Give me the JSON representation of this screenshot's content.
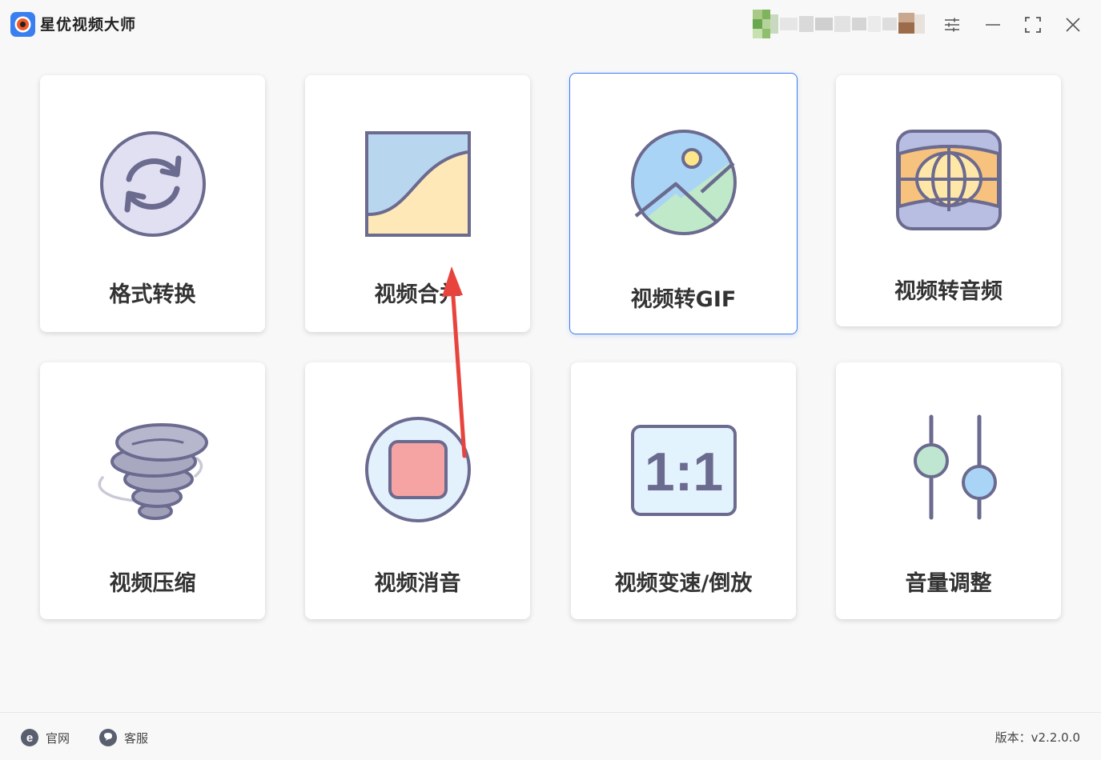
{
  "app": {
    "title": "星优视频大师"
  },
  "cards": [
    {
      "id": "format-convert",
      "label": "格式转换",
      "icon": "refresh-icon"
    },
    {
      "id": "video-merge",
      "label": "视频合并",
      "icon": "merge-curve-icon"
    },
    {
      "id": "video-to-gif",
      "label": "视频转GIF",
      "icon": "image-landscape-icon",
      "selected": true
    },
    {
      "id": "video-to-audio",
      "label": "视频转音频",
      "icon": "panorama-globe-icon"
    },
    {
      "id": "video-compress",
      "label": "视频压缩",
      "icon": "tornado-icon"
    },
    {
      "id": "video-mute",
      "label": "视频消音",
      "icon": "stop-square-icon"
    },
    {
      "id": "video-speed",
      "label": "视频变速/倒放",
      "icon": "ratio-1-1-icon"
    },
    {
      "id": "volume-adjust",
      "label": "音量调整",
      "icon": "sliders-icon"
    }
  ],
  "ratio_icon_text": "1:1",
  "footer": {
    "site_label": "官网",
    "service_label": "客服",
    "version_text": "版本：v2.2.0.0"
  },
  "colors": {
    "accent": "#3d7bf0",
    "icon_stroke": "#6b6a8f",
    "annotation": "#e8443e"
  }
}
